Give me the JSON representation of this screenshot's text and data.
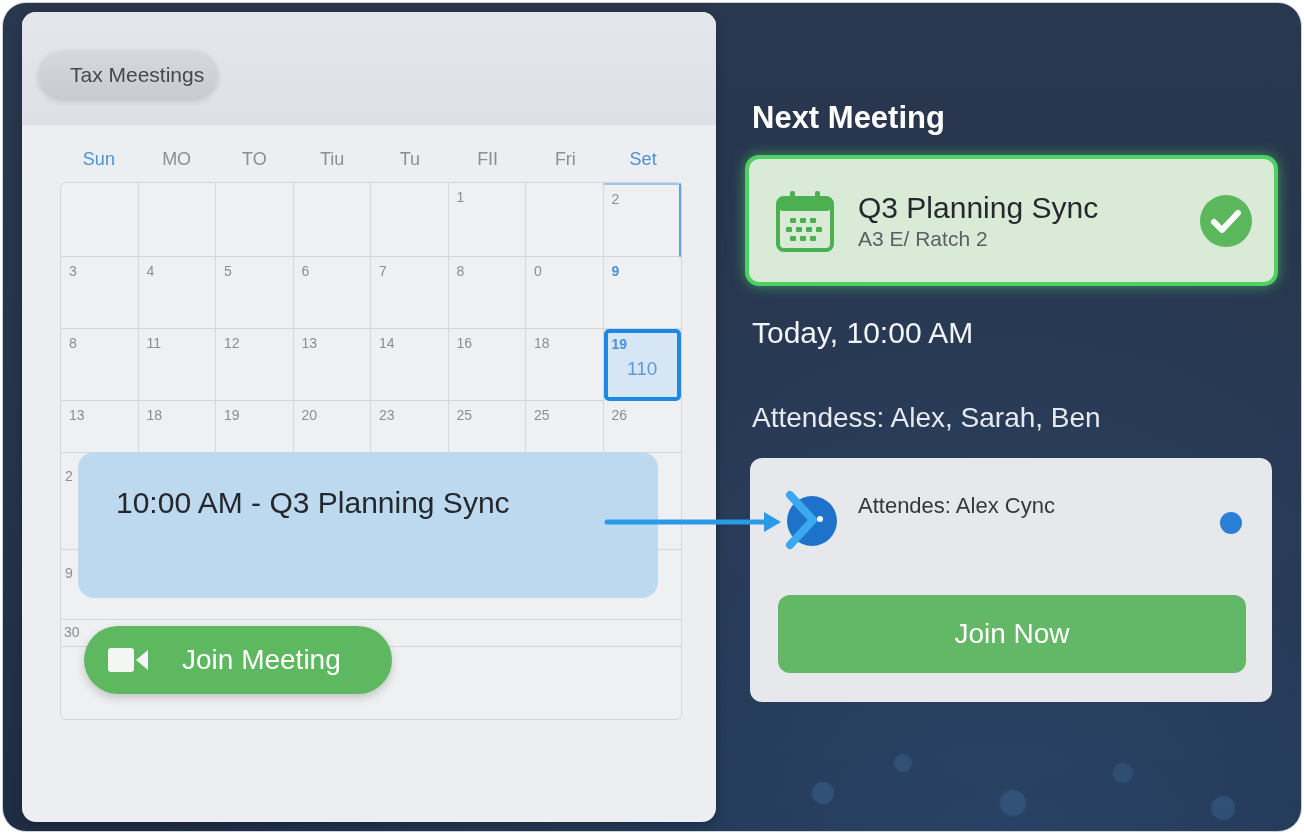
{
  "calendar": {
    "title": "Tax Meestings",
    "weekdays": [
      {
        "label": "Sun",
        "accent": true
      },
      {
        "label": "MO",
        "accent": false
      },
      {
        "label": "TO",
        "accent": false
      },
      {
        "label": "Tiu",
        "accent": false
      },
      {
        "label": "Tu",
        "accent": false
      },
      {
        "label": "FII",
        "accent": false
      },
      {
        "label": "Fri",
        "accent": false
      },
      {
        "label": "Set",
        "accent": true
      }
    ],
    "weeks": [
      [
        {
          "selected": false,
          "outlined": false
        },
        {
          "selected": false,
          "outlined": false
        },
        {
          "selected": false,
          "outlined": false
        },
        {
          "selected": false,
          "outlined": false
        },
        {
          "selected": false,
          "outlined": false
        },
        {
          "day": "1",
          "accent": false,
          "selected": false,
          "outlined": false
        },
        {
          "selected": false,
          "outlined": false
        },
        {
          "day": "2",
          "accent": false,
          "selected": false,
          "outlined": true
        }
      ],
      [
        {
          "day": "3",
          "accent": false,
          "selected": false,
          "outlined": false
        },
        {
          "day": "4",
          "accent": false,
          "selected": false,
          "outlined": false
        },
        {
          "day": "5",
          "accent": false,
          "selected": false,
          "outlined": false
        },
        {
          "day": "6",
          "accent": false,
          "selected": false,
          "outlined": false
        },
        {
          "day": "7",
          "accent": false,
          "selected": false,
          "outlined": false
        },
        {
          "day": "8",
          "accent": false,
          "selected": false,
          "outlined": false
        },
        {
          "day": "0",
          "accent": false,
          "selected": false,
          "outlined": false
        },
        {
          "day": "9",
          "accent": true,
          "selected": false,
          "outlined": false
        }
      ],
      [
        {
          "day": "8",
          "accent": false,
          "selected": false,
          "outlined": false
        },
        {
          "day": "11",
          "accent": false,
          "selected": false,
          "outlined": false
        },
        {
          "day": "12",
          "accent": false,
          "selected": false,
          "outlined": false
        },
        {
          "day": "13",
          "accent": false,
          "selected": false,
          "outlined": false
        },
        {
          "day": "14",
          "accent": false,
          "selected": false,
          "outlined": false
        },
        {
          "day": "16",
          "accent": false,
          "selected": false,
          "outlined": false
        },
        {
          "day": "18",
          "accent": false,
          "selected": false,
          "outlined": false
        },
        {
          "day": "19",
          "note": "110",
          "accent": true,
          "selected": true,
          "outlined": false
        }
      ],
      [
        {
          "day": "13",
          "accent": false,
          "selected": false,
          "outlined": false
        },
        {
          "day": "18",
          "accent": false,
          "selected": false,
          "outlined": false
        },
        {
          "day": "19",
          "accent": false,
          "selected": false,
          "outlined": false
        },
        {
          "day": "20",
          "accent": false,
          "selected": false,
          "outlined": false
        },
        {
          "day": "23",
          "accent": false,
          "selected": false,
          "outlined": false
        },
        {
          "day": "25",
          "accent": false,
          "selected": false,
          "outlined": false
        },
        {
          "day": "25",
          "accent": false,
          "selected": false,
          "outlined": false
        },
        {
          "day": "26",
          "accent": false,
          "selected": false,
          "outlined": false
        }
      ],
      [
        {
          "day": "2",
          "accent": false,
          "selected": false,
          "outlined": false
        }
      ],
      [
        {
          "day": "9",
          "accent": false,
          "selected": false,
          "outlined": false
        }
      ],
      [
        {
          "day": "30",
          "accent": false,
          "selected": false,
          "outlined": false
        }
      ]
    ],
    "event": {
      "text": "10:00 AM - Q3 Planning Sync"
    },
    "join_button": {
      "label": "Join Meeting"
    }
  },
  "next_meeting": {
    "heading": "Next Meeting",
    "card": {
      "title": "Q3 Planning Sync",
      "subtitle": "A3 E/ Ratch 2",
      "confirmed": true
    },
    "time": "Today, 10:00 AM",
    "attendees": "Attendess: Alex, Sarah, Ben",
    "attendee_card": {
      "text": "Attendes: Alex Cync",
      "button": "Join Now"
    }
  }
}
